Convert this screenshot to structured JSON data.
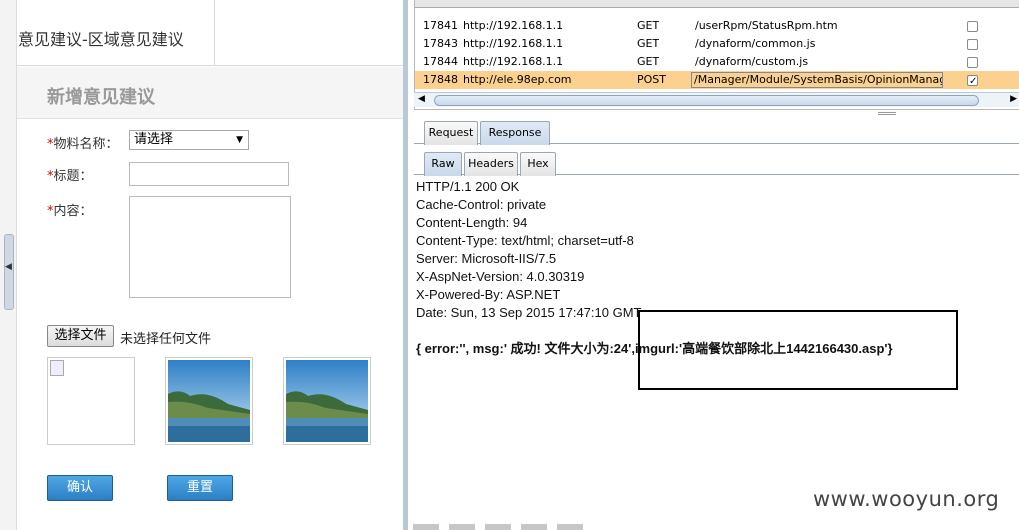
{
  "left": {
    "header_title": "意见建议-区域意见建议",
    "form_title": "新增意见建议",
    "fields": {
      "material": {
        "label": "物料名称：",
        "required_mark": "*",
        "selected": "请选择"
      },
      "title": {
        "label": "标题：",
        "required_mark": "*",
        "value": ""
      },
      "content": {
        "label": "内容：",
        "required_mark": "*",
        "value": ""
      }
    },
    "file": {
      "button_label": "选择文件",
      "status": "未选择任何文件"
    },
    "confirm_label": "确认",
    "reset_label": "重置"
  },
  "proxy": {
    "rows": [
      {
        "id": "17841",
        "host": "http://192.168.1.1",
        "method": "GET",
        "url": "/userRpm/StatusRpm.htm",
        "params": false
      },
      {
        "id": "17843",
        "host": "http://192.168.1.1",
        "method": "GET",
        "url": "/dynaform/common.js",
        "params": false
      },
      {
        "id": "17844",
        "host": "http://192.168.1.1",
        "method": "GET",
        "url": "/dynaform/custom.js",
        "params": false
      },
      {
        "id": "17848",
        "host": "http://ele.98ep.com",
        "method": "POST",
        "url": "/Manager/Module/SystemBasis/OpinionManage/U...",
        "params": true
      }
    ]
  },
  "tabs": {
    "level1": [
      "Request",
      "Response"
    ],
    "level2": [
      "Raw",
      "Headers",
      "Hex"
    ]
  },
  "response": {
    "lines": [
      "HTTP/1.1 200 OK",
      "Cache-Control: private",
      "Content-Length: 94",
      "Content-Type: text/html; charset=utf-8",
      "Server: Microsoft-IIS/7.5",
      "X-AspNet-Version: 4.0.30319",
      "X-Powered-By: ASP.NET",
      "Date: Sun, 13 Sep 2015 17:47:10 GMT"
    ],
    "json": "{ error:'', msg:' 成功! 文件大小为:24',imgurl:'高端餐饮部除北上1442166430.asp'}"
  },
  "watermark": "www.wooyun.org",
  "colors": {
    "selected_row": "#fcd08e",
    "button_blue": "#2b7fc4",
    "required": "#dd0000"
  }
}
